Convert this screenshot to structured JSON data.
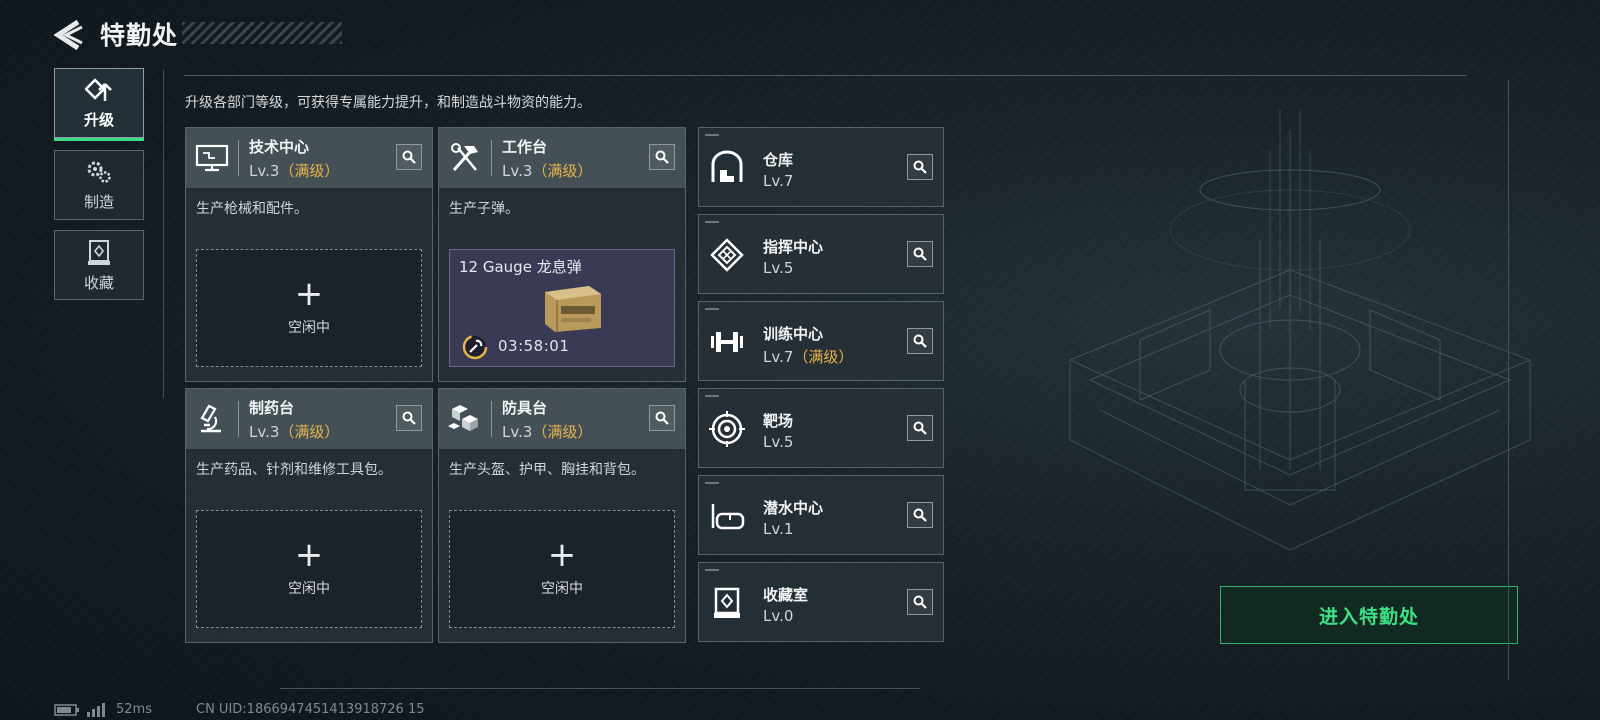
{
  "header": {
    "title": "特勤处",
    "back_icon": "back-arrow-icon"
  },
  "sidebar": {
    "tabs": [
      {
        "label": "升级",
        "icon": "upgrade-icon",
        "active": true
      },
      {
        "label": "制造",
        "icon": "gears-icon",
        "active": false
      },
      {
        "label": "收藏",
        "icon": "collection-icon",
        "active": false
      }
    ]
  },
  "description": "升级各部门等级，可获得专属能力提升，和制造战斗物资的能力。",
  "cards": [
    {
      "name": "技术中心",
      "level": "Lv.3",
      "max_tag": "（满级）",
      "icon": "monitor-icon",
      "desc": "生产枪械和配件。",
      "slot": {
        "plus": "+",
        "status": "空闲中"
      }
    },
    {
      "name": "工作台",
      "level": "Lv.3",
      "max_tag": "（满级）",
      "icon": "tools-icon",
      "desc": "生产子弹。",
      "production": {
        "item": "12 Gauge 龙息弹",
        "time_left": "03:58:01"
      }
    },
    {
      "name": "制药台",
      "level": "Lv.3",
      "max_tag": "（满级）",
      "icon": "microscope-icon",
      "desc": "生产药品、针剂和维修工具包。",
      "slot": {
        "plus": "+",
        "status": "空闲中"
      }
    },
    {
      "name": "防具台",
      "level": "Lv.3",
      "max_tag": "（满级）",
      "icon": "cubes-icon",
      "desc": "生产头盔、护甲、胸挂和背包。",
      "slot": {
        "plus": "+",
        "status": "空闲中"
      }
    }
  ],
  "departments": [
    {
      "name": "仓库",
      "level": "Lv.7",
      "max_tag": "",
      "icon": "warehouse-icon"
    },
    {
      "name": "指挥中心",
      "level": "Lv.5",
      "max_tag": "",
      "icon": "chip-icon"
    },
    {
      "name": "训练中心",
      "level": "Lv.7",
      "max_tag": "（满级）",
      "icon": "dumbbell-icon"
    },
    {
      "name": "靶场",
      "level": "Lv.5",
      "max_tag": "",
      "icon": "target-icon"
    },
    {
      "name": "潜水中心",
      "level": "Lv.1",
      "max_tag": "",
      "icon": "diving-mask-icon"
    },
    {
      "name": "收藏室",
      "level": "Lv.0",
      "max_tag": "",
      "icon": "display-case-icon"
    }
  ],
  "enter_button": "进入特勤处",
  "status_bar": {
    "ping": "52ms",
    "uid": "CN UID:1866947451413918726 15"
  },
  "colors": {
    "accent_green": "#3ddc84",
    "max_level": "#e6b34a"
  }
}
